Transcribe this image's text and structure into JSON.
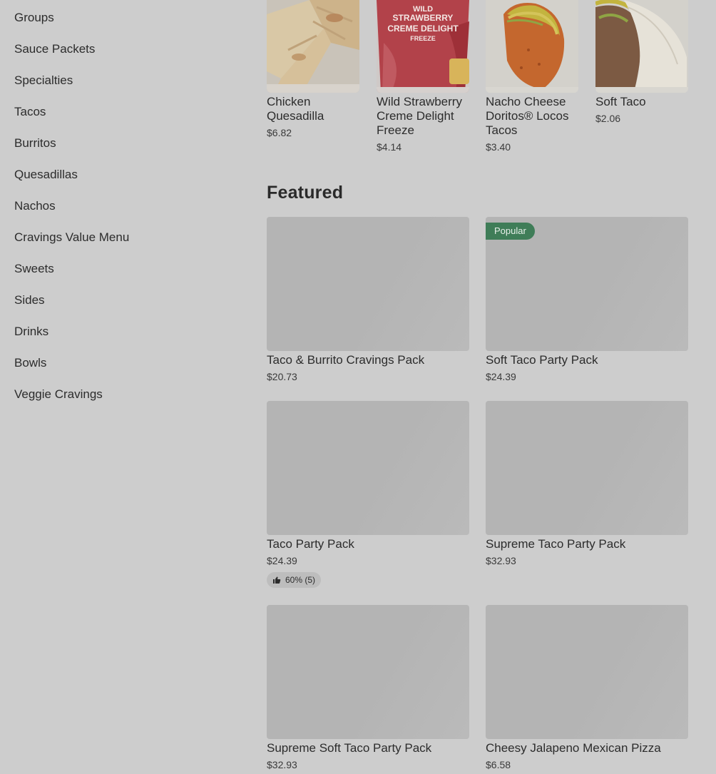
{
  "sidebar": {
    "items": [
      {
        "label": "Groups"
      },
      {
        "label": "Sauce Packets"
      },
      {
        "label": "Specialties"
      },
      {
        "label": "Tacos"
      },
      {
        "label": "Burritos"
      },
      {
        "label": "Quesadillas"
      },
      {
        "label": "Nachos"
      },
      {
        "label": "Cravings Value Menu"
      },
      {
        "label": "Sweets"
      },
      {
        "label": "Sides"
      },
      {
        "label": "Drinks"
      },
      {
        "label": "Bowls"
      },
      {
        "label": "Veggie Cravings"
      }
    ]
  },
  "carousel": {
    "items": [
      {
        "name": "Chicken Quesadilla",
        "price": "$6.82",
        "image": "chicken-quesadilla-image"
      },
      {
        "name": "Wild Strawberry Creme Delight Freeze",
        "price": "$4.14",
        "image": "strawberry-freeze-image",
        "cup_text_1": "WILD",
        "cup_text_2": "STRAWBERRY",
        "cup_text_3": "CREME DELIGHT",
        "cup_text_4": "FREEZE"
      },
      {
        "name": "Nacho Cheese Doritos® Locos Tacos",
        "price": "$3.40",
        "image": "doritos-locos-taco-image"
      },
      {
        "name": "Soft Taco",
        "price": "$2.06",
        "image": "soft-taco-image"
      }
    ]
  },
  "featured": {
    "title": "Featured",
    "items": [
      {
        "name": "Taco & Burrito Cravings Pack",
        "price": "$20.73"
      },
      {
        "name": "Soft Taco Party Pack",
        "price": "$24.39",
        "badge": "Popular"
      },
      {
        "name": "Taco Party Pack",
        "price": "$24.39",
        "rating": "60% (5)"
      },
      {
        "name": "Supreme Taco Party Pack",
        "price": "$32.93"
      },
      {
        "name": "Supreme Soft Taco Party Pack",
        "price": "$32.93"
      },
      {
        "name": "Cheesy Jalapeno Mexican Pizza",
        "price": "$6.58"
      }
    ]
  },
  "colors": {
    "overlay_background": "#cdcdcd",
    "popular_badge": "#3f7d58",
    "image_placeholder": "#b4b4b4"
  }
}
